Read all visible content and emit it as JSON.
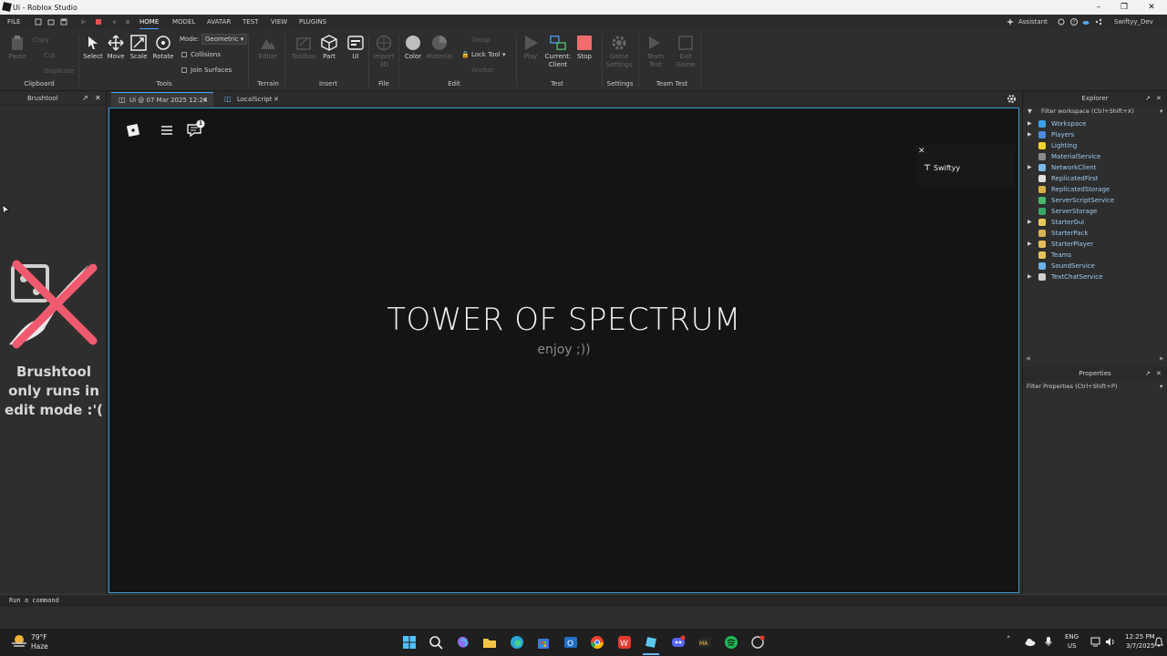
{
  "window": {
    "title": "Ui - Roblox Studio"
  },
  "menubar": {
    "tabs": [
      "FILE",
      "HOME",
      "MODEL",
      "AVATAR",
      "TEST",
      "VIEW",
      "PLUGINS"
    ],
    "assistant": "Assistant",
    "username": "Swiftyy_Dev"
  },
  "ribbon": {
    "clipboard": {
      "paste": "Paste",
      "copy": "Copy",
      "cut": "Cut",
      "duplicate": "Duplicate",
      "group": "Clipboard"
    },
    "tools": {
      "select": "Select",
      "move": "Move",
      "scale": "Scale",
      "rotate": "Rotate",
      "mode_label": "Mode:",
      "mode_value": "Geometric",
      "collisions": "Collisions",
      "join_surfaces": "Join Surfaces",
      "group": "Tools"
    },
    "terrain": {
      "editor": "Editor",
      "group": "Terrain"
    },
    "insert": {
      "toolbox": "Toolbox",
      "part": "Part",
      "ui": "UI",
      "group": "Insert"
    },
    "file": {
      "import3d": "Import 3D",
      "group": "File"
    },
    "edit": {
      "color": "Color",
      "material": "Material",
      "group_btn": "Group",
      "lock_tool": "Lock Tool",
      "anchor": "Anchor",
      "group": "Edit"
    },
    "test": {
      "play": "Play",
      "current_client": "Current: Client",
      "stop": "Stop",
      "group": "Test"
    },
    "settings": {
      "game_settings": "Game Settings",
      "group": "Settings"
    },
    "team_test": {
      "team_test": "Team Test",
      "exit_game": "Exit Game",
      "group": "Team Test"
    }
  },
  "left_panel": {
    "title": "Brushtool",
    "message": "Brushtool only runs in edit mode :'("
  },
  "editor_tabs": [
    {
      "label": "Ui @ 07 Mar 2025 12:24"
    },
    {
      "label": "LocalScript"
    }
  ],
  "viewport": {
    "game_title": "TOWER OF SPECTRUM",
    "subtitle": "enjoy ;))",
    "notification_count": "1",
    "player_name": "Swiftyy"
  },
  "explorer": {
    "title": "Explorer",
    "filter": "Filter workspace (Ctrl+Shift+X)",
    "items": [
      {
        "label": "Workspace",
        "expandable": true,
        "color": "#3ca0e8"
      },
      {
        "label": "Players",
        "expandable": true,
        "color": "#4c8be0"
      },
      {
        "label": "Lighting",
        "expandable": false,
        "color": "#f2d22e"
      },
      {
        "label": "MaterialService",
        "expandable": false,
        "color": "#8c8c8c"
      },
      {
        "label": "NetworkClient",
        "expandable": true,
        "color": "#7ab8e6"
      },
      {
        "label": "ReplicatedFirst",
        "expandable": false,
        "color": "#e0e0e0"
      },
      {
        "label": "ReplicatedStorage",
        "expandable": false,
        "color": "#d8b04a"
      },
      {
        "label": "ServerScriptService",
        "expandable": false,
        "color": "#4ab86a"
      },
      {
        "label": "ServerStorage",
        "expandable": false,
        "color": "#3aa865"
      },
      {
        "label": "StarterGui",
        "expandable": true,
        "color": "#e8c75a"
      },
      {
        "label": "StarterPack",
        "expandable": false,
        "color": "#d9b257"
      },
      {
        "label": "StarterPlayer",
        "expandable": true,
        "color": "#e3bd5a"
      },
      {
        "label": "Teams",
        "expandable": false,
        "color": "#e6c35c"
      },
      {
        "label": "SoundService",
        "expandable": false,
        "color": "#6ab0e6"
      },
      {
        "label": "TextChatService",
        "expandable": true,
        "color": "#d0d0d0"
      }
    ]
  },
  "properties": {
    "title": "Properties",
    "filter": "Filter Properties (Ctrl+Shift+P)"
  },
  "command_bar": {
    "placeholder": "Run a command"
  },
  "taskbar": {
    "weather_temp": "79°F",
    "weather_desc": "Haze",
    "lang": "ENG",
    "region": "US",
    "time": "12:25 PM",
    "date": "3/7/2025"
  }
}
